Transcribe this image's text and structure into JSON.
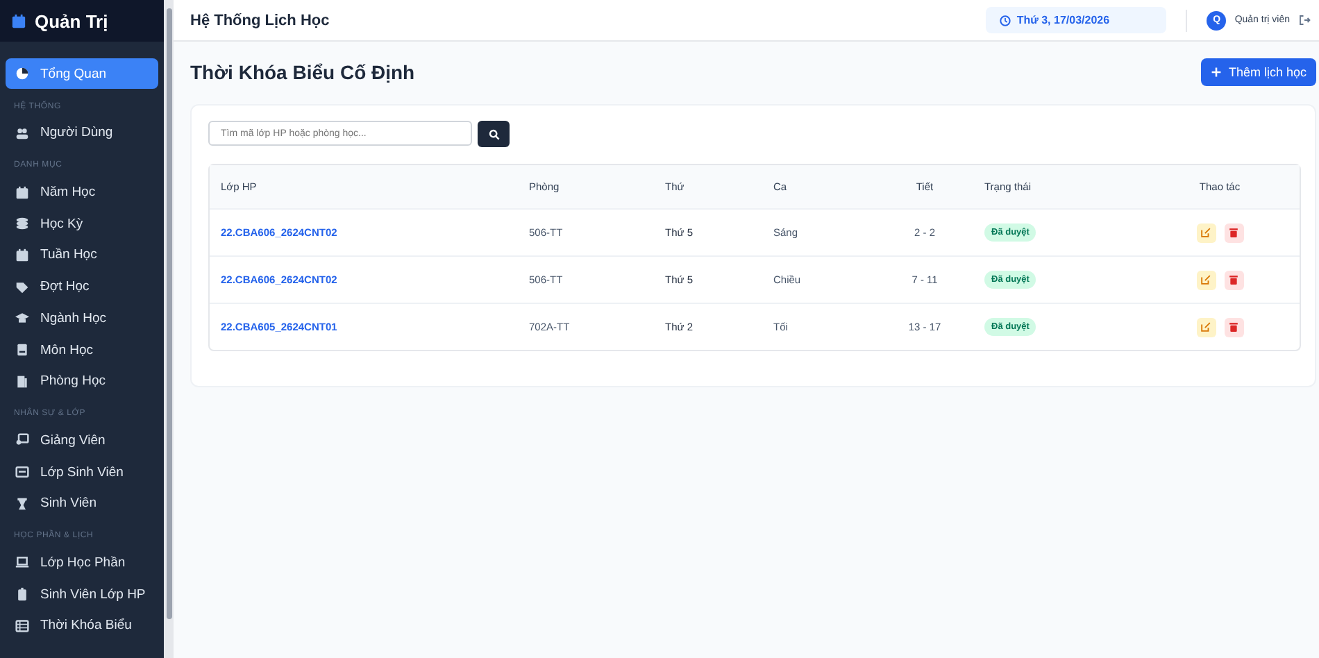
{
  "sidebar": {
    "brand": "Quản Trị",
    "sections": [
      {
        "items": [
          {
            "label": "Tổng Quan",
            "kind": "chart",
            "selected": true
          }
        ]
      },
      {
        "title": "HỆ THỐNG",
        "items": [
          {
            "label": "Người Dùng",
            "kind": "users",
            "selected": false
          }
        ]
      },
      {
        "title": "DANH MỤC",
        "items": [
          {
            "label": "Năm Học",
            "kind": "calendar",
            "selected": false
          },
          {
            "label": "Học Kỳ",
            "kind": "layers",
            "selected": false
          },
          {
            "label": "Tuần Học",
            "kind": "calendar",
            "selected": false
          },
          {
            "label": "Đợt Học",
            "kind": "tag",
            "selected": false
          },
          {
            "label": "Ngành Học",
            "kind": "cap",
            "selected": false
          },
          {
            "label": "Môn Học",
            "kind": "book",
            "selected": false
          },
          {
            "label": "Phòng Học",
            "kind": "door",
            "selected": false
          }
        ]
      },
      {
        "title": "NHÂN SỰ & LỚP",
        "items": [
          {
            "label": "Giảng Viên",
            "kind": "board",
            "selected": false
          },
          {
            "label": "Lớp Sinh Viên",
            "kind": "card",
            "selected": false
          },
          {
            "label": "Sinh Viên",
            "kind": "person",
            "selected": false
          }
        ]
      },
      {
        "title": "HỌC PHẦN & LỊCH",
        "items": [
          {
            "label": "Lớp Học Phần",
            "kind": "laptop",
            "selected": false
          },
          {
            "label": "Sinh Viên Lớp HP",
            "kind": "badge",
            "selected": false
          },
          {
            "label": "Thời Khóa Biểu",
            "kind": "table",
            "selected": false
          }
        ]
      }
    ]
  },
  "topbar": {
    "title": "Hệ Thống Lịch Học",
    "datetime": "Thứ 3, 17/03/2026",
    "user": "Quản trị viên",
    "avatar": "Q"
  },
  "page": {
    "title": "Thời Khóa Biểu Cố Định",
    "add_button": "Thêm lịch học"
  },
  "search": {
    "placeholder": "Tìm mã lớp HP hoặc phòng học..."
  },
  "table": {
    "columns": [
      "Lớp HP",
      "Phòng",
      "Thứ",
      "Ca",
      "Tiết",
      "Trạng thái",
      "Thao tác"
    ],
    "rows": [
      {
        "class": "22.CBA606_2624CNT02",
        "room": "506-TT",
        "day": "Thứ 5",
        "shift": "Sáng",
        "period": "2 - 2",
        "status": "Đã duyệt"
      },
      {
        "class": "22.CBA606_2624CNT02",
        "room": "506-TT",
        "day": "Thứ 5",
        "shift": "Chiều",
        "period": "7 - 11",
        "status": "Đã duyệt"
      },
      {
        "class": "22.CBA605_2624CNT01",
        "room": "702A-TT",
        "day": "Thứ 2",
        "shift": "Tối",
        "period": "13 - 17",
        "status": "Đã duyệt"
      }
    ]
  }
}
